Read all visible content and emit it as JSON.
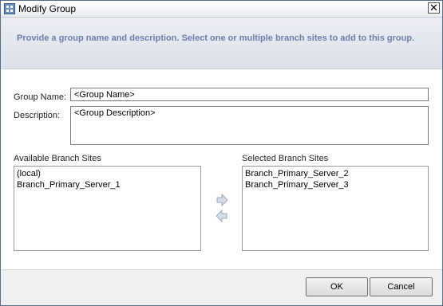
{
  "window": {
    "title": "Modify Group",
    "close_glyph": "✕"
  },
  "banner": {
    "text": "Provide a group name and description. Select one or multiple branch sites to add to this group."
  },
  "form": {
    "group_name_label": "Group Name:",
    "group_name_value": "<Group Name>",
    "description_label": "Description:",
    "description_value": "<Group Description>"
  },
  "available": {
    "label": "Available Branch Sites",
    "items": [
      "(local)",
      "Branch_Primary_Server_1"
    ]
  },
  "selected": {
    "label": "Selected Branch Sites",
    "items": [
      "Branch_Primary_Server_2",
      "Branch_Primary_Server_3"
    ]
  },
  "arrows": {
    "add_icon": "arrow-right-icon",
    "remove_icon": "arrow-left-icon"
  },
  "buttons": {
    "ok": "OK",
    "cancel": "Cancel"
  }
}
